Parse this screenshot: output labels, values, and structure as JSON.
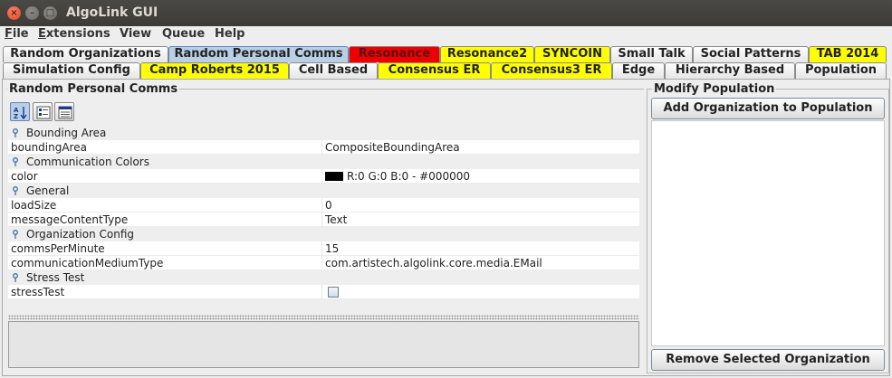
{
  "window": {
    "title": "AlgoLink GUI"
  },
  "menu": [
    {
      "label": "File",
      "mnemonic": "F",
      "rest": "ile"
    },
    {
      "label": "Extensions",
      "mnemonic": "E",
      "rest": "xtensions"
    },
    {
      "label": "View",
      "mnemonic": "",
      "rest": "View"
    },
    {
      "label": "Queue",
      "mnemonic": "",
      "rest": "Queue"
    },
    {
      "label": "Help",
      "mnemonic": "",
      "rest": "Help"
    }
  ],
  "tabs_row1": [
    "Random Organizations",
    "Random Personal Comms",
    "Resonance",
    "Resonance2",
    "SYNCOIN",
    "Small Talk",
    "Social Patterns",
    "TAB 2014"
  ],
  "tabs_row2": [
    "Simulation Config",
    "Camp Roberts 2015",
    "Cell Based",
    "Consensus ER",
    "Consensus3 ER",
    "Edge",
    "Hierarchy Based",
    "Population"
  ],
  "colors": {
    "selected_tab": "#b8cfe5",
    "red_tab": "#ee0000",
    "yellow_tab": "#ffff00"
  },
  "left_panel": {
    "title": "Random Personal Comms",
    "toolbar": [
      "sort-alphabetical-icon",
      "sort-category-icon",
      "show-description-icon"
    ]
  },
  "properties": {
    "cat_bounding": "Bounding Area",
    "boundingArea_name": "boundingArea",
    "boundingArea_value": "CompositeBoundingArea",
    "cat_colors": "Communication Colors",
    "color_name": "color",
    "color_value": "R:0 G:0 B:0 - #000000",
    "cat_general": "General",
    "loadSize_name": "loadSize",
    "loadSize_value": "0",
    "messageContentType_name": "messageContentType",
    "messageContentType_value": "Text",
    "cat_org": "Organization Config",
    "commsPerMinute_name": "commsPerMinute",
    "commsPerMinute_value": "15",
    "communicationMediumType_name": "communicationMediumType",
    "communicationMediumType_value": "com.artistech.algolink.core.media.EMail",
    "cat_stress": "Stress Test",
    "stressTest_name": "stressTest",
    "stressTest_checked": false
  },
  "right_panel": {
    "title": "Modify Population",
    "add_button": "Add Organization to Population",
    "remove_button": "Remove Selected Organization"
  }
}
